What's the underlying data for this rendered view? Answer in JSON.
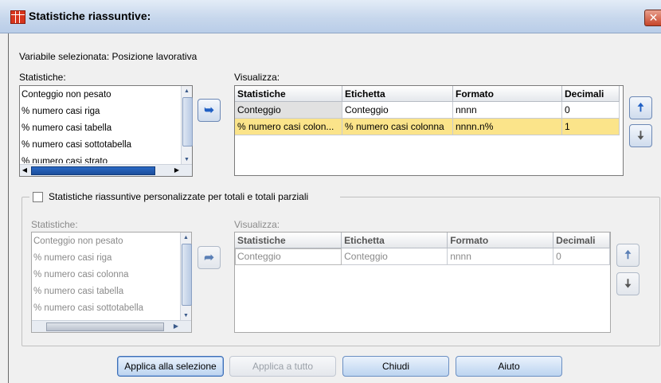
{
  "window": {
    "title": "Statistiche riassuntive:",
    "close_glyph": "✕"
  },
  "selected_variable": "Variabile selezionata: Posizione lavorativa",
  "top": {
    "stats_label": "Statistiche:",
    "stats_items": [
      "Conteggio non pesato",
      "% numero casi riga",
      "% numero casi tabella",
      "% numero casi sottotabella",
      "% numero casi strato"
    ],
    "display_label": "Visualizza:",
    "columns": [
      "Statistiche",
      "Etichetta",
      "Formato",
      "Decimali"
    ],
    "rows": [
      [
        "Conteggio",
        "Conteggio",
        "nnnn",
        "0"
      ],
      [
        "% numero casi colon...",
        "% numero casi colonna",
        "nnnn.n%",
        "1"
      ]
    ],
    "up_icon": "arrow-up-icon",
    "down_icon": "arrow-down-icon",
    "move_icon": "arrow-left-icon"
  },
  "bottom": {
    "checkbox_label": "Statistiche riassuntive personalizzate per totali e totali parziali",
    "checked": false,
    "stats_label": "Statistiche:",
    "stats_items": [
      "Conteggio non pesato",
      "% numero casi riga",
      "% numero casi colonna",
      "% numero casi tabella",
      "% numero casi sottotabella"
    ],
    "display_label": "Visualizza:",
    "columns": [
      "Statistiche",
      "Etichetta",
      "Formato",
      "Decimali"
    ],
    "rows": [
      [
        "Conteggio",
        "Conteggio",
        "nnnn",
        "0"
      ]
    ],
    "move_icon": "arrow-right-icon"
  },
  "buttons": {
    "apply_selection": "Applica alla selezione",
    "apply_all": "Applica a tutto",
    "close": "Chiudi",
    "help": "Aiuto"
  }
}
